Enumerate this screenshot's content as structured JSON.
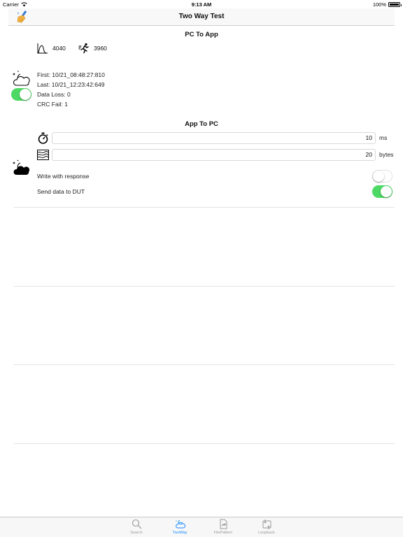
{
  "status_bar": {
    "carrier": "Carrier",
    "time": "9:13 AM",
    "battery": "100%",
    "battery_level": 1.0
  },
  "nav": {
    "title": "Two Way Test",
    "left_icon": "broom-icon"
  },
  "pc_to_app": {
    "title": "PC To App",
    "peak_value": "4040",
    "speed_value": "3960",
    "first": "First: 10/21_08:48:27:810",
    "last": "Last: 10/21_12:23:42:649",
    "data_loss": "Data Loss: 0",
    "crc_fail": "CRC Fail: 1",
    "toggle_on": true
  },
  "app_to_pc": {
    "title": "App To PC",
    "interval_value": "10",
    "interval_unit": "ms",
    "size_value": "20",
    "size_unit": "bytes",
    "write_with_response_label": "Write with response",
    "write_with_response_on": false,
    "send_data_label": "Send data to DUT",
    "send_data_on": true
  },
  "tabs": [
    {
      "label": "Search",
      "icon": "search-icon",
      "active": false
    },
    {
      "label": "TwoWay",
      "icon": "cloud-icon",
      "active": true
    },
    {
      "label": "FilePattern",
      "icon": "file-share-icon",
      "active": false
    },
    {
      "label": "Loopback",
      "icon": "loopback-icon",
      "active": false
    }
  ],
  "colors": {
    "toggle_on": "#4cd964",
    "tab_active": "#1a8cff",
    "tab_inactive": "#9a9a9a"
  }
}
